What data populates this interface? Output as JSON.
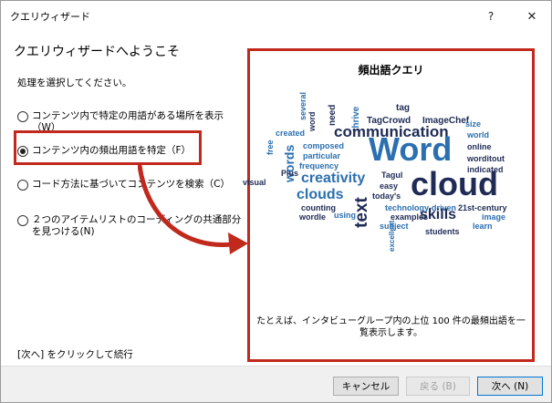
{
  "window": {
    "title": "クエリウィザード",
    "help_glyph": "?",
    "close_glyph": "✕"
  },
  "main": {
    "welcome": "クエリウィザードへようこそ",
    "instruction": "処理を選択してください。",
    "options": [
      {
        "label": "コンテンツ内で特定の用語がある場所を表示（W）",
        "checked": false
      },
      {
        "label": "コンテンツ内の頻出用語を特定（F）",
        "checked": true
      },
      {
        "label": "コード方法に基づいてコンテンツを検索（C）",
        "checked": false
      },
      {
        "label": "２つのアイテムリストのコーディングの共通部分を見つける(N)",
        "checked": false
      }
    ],
    "next_hint": "[次へ] をクリックして続行"
  },
  "preview": {
    "title": "頻出語クエリ",
    "description": "たとえば、インタビューグループ内の上位 100 件の最頻出語を一覧表示します。",
    "cloud_words": [
      "tag",
      "several",
      "need",
      "thrive",
      "TagCrowd",
      "ImageChef",
      "size",
      "created",
      "word",
      "communication",
      "world",
      "free",
      "composed",
      "online",
      "words",
      "Word",
      "worditout",
      "particular",
      "Plus",
      "frequency",
      "indicated",
      "visual",
      "creativity",
      "Tagul",
      "cloud",
      "easy",
      "today's",
      "clouds",
      "text",
      "technology-driven",
      "21st-century",
      "image",
      "counting",
      "wordle",
      "using",
      "skills",
      "examples",
      "learn",
      "subject",
      "excellent",
      "students"
    ],
    "palette": {
      "navy": "#1f2b55",
      "blue": "#2b6fb0",
      "light": "#7aa7d6"
    }
  },
  "footer": {
    "cancel": "キャンセル",
    "back": "戻る (B)",
    "next": "次へ (N)"
  },
  "colors": {
    "highlight": "#c0291b"
  }
}
